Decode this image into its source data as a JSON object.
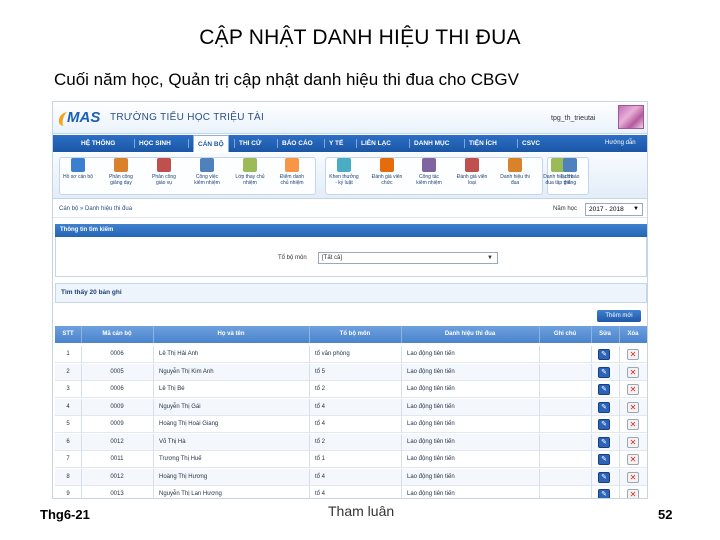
{
  "slide": {
    "title": "CẬP NHẬT DANH HIỆU THI ĐUA",
    "subtitle": "Cuối năm học, Quản trị cập nhật danh hiệu thi đua cho CBGV",
    "footer_left": "Thg6-21",
    "footer_mid": "Tham luân",
    "footer_right": "52"
  },
  "app": {
    "logo": "MAS",
    "school_name": "TRƯỜNG TIỂU HỌC TRIỆU TÀI",
    "user": "tpg_th_trieutai",
    "help": "Hướng dẫn",
    "menu": [
      "HỆ THỐNG",
      "HỌC SINH",
      "CÁN BỘ",
      "THI CỬ",
      "BÁO CÁO",
      "Y TẾ",
      "LIÊN LẠC",
      "DANH MỤC",
      "TIỆN ÍCH",
      "CSVC"
    ],
    "toolbar": [
      {
        "label": "Hồ sơ cán bộ",
        "icon": "user-card-icon",
        "color": "#3b7fd0"
      },
      {
        "label": "Phân công\ngiảng dạy",
        "icon": "assign-teaching-icon",
        "color": "#d9822b"
      },
      {
        "label": "Phân công\ngiáo vụ",
        "icon": "assign-duty-icon",
        "color": "#c0504d"
      },
      {
        "label": "Công việc\nkiêm nhiệm",
        "icon": "concurrent-work-icon",
        "color": "#4f81bd"
      },
      {
        "label": "Lớp thay chủ\nnhiệm",
        "icon": "substitute-class-icon",
        "color": "#9bbb59"
      },
      {
        "label": "Điểm danh\nchủ nhiệm",
        "icon": "attendance-icon",
        "color": "#f79646"
      },
      {
        "label": "Khen thưởng\n- kỷ luật",
        "icon": "reward-discipline-icon",
        "color": "#4bacc6"
      },
      {
        "label": "Đánh giá viên\nchức",
        "icon": "evaluation-icon",
        "color": "#e46c0a"
      },
      {
        "label": "Công tác\nkiêm nhiệm",
        "icon": "concurrent-task-icon",
        "color": "#8064a2"
      },
      {
        "label": "Đánh giá viên\nloại",
        "icon": "rating-icon",
        "color": "#c0504d"
      },
      {
        "label": "Danh hiệu thi\nđua",
        "icon": "emulation-title-icon",
        "color": "#d9822b"
      },
      {
        "label": "Danh hiệu thi\nđua tập thể",
        "icon": "group-title-icon",
        "color": "#9bbb59"
      },
      {
        "label": "Lịch báo\ngiảng",
        "icon": "schedule-icon",
        "color": "#4f81bd"
      }
    ],
    "breadcrumb": "Cán bộ » Danh hiệu thi đua",
    "year_label": "Năm học",
    "year_value": "2017 - 2018",
    "search_panel_title": "Thông tin tìm kiếm",
    "dept_label": "Tổ bộ môn",
    "dept_value": "[Tất cả]",
    "result_count": "Tìm thấy 20 bản ghi",
    "add_button": "Thêm mới",
    "table": {
      "headers": [
        "STT",
        "Mã cán bộ",
        "Họ và tên",
        "Tổ bộ môn",
        "Danh hiệu thi đua",
        "Ghi chú",
        "Sửa",
        "Xóa"
      ],
      "rows": [
        [
          "1",
          "0006",
          "Lê Thị Hải Anh",
          "tổ văn phòng",
          "Lao động tiên tiến",
          ""
        ],
        [
          "2",
          "0005",
          "Nguyễn Thị Kim Anh",
          "tổ 5",
          "Lao động tiên tiến",
          ""
        ],
        [
          "3",
          "0006",
          "Lê Thị Bé",
          "tổ 2",
          "Lao động tiên tiến",
          ""
        ],
        [
          "4",
          "0009",
          "Nguyễn Thị Gái",
          "tổ 4",
          "Lao động tiên tiến",
          ""
        ],
        [
          "5",
          "0009",
          "Hoàng Thị Hoài Giang",
          "tổ 4",
          "Lao động tiên tiến",
          ""
        ],
        [
          "6",
          "0012",
          "Võ Thị Hà",
          "tổ 2",
          "Lao động tiên tiến",
          ""
        ],
        [
          "7",
          "0011",
          "Trương Thị Huế",
          "tổ 1",
          "Lao động tiên tiến",
          ""
        ],
        [
          "8",
          "0012",
          "Hoàng Thị Hương",
          "tổ 4",
          "Lao động tiên tiến",
          ""
        ],
        [
          "9",
          "0013",
          "Nguyễn Thị Lan Hương",
          "tổ 4",
          "Lao động tiên tiến",
          ""
        ]
      ]
    }
  }
}
